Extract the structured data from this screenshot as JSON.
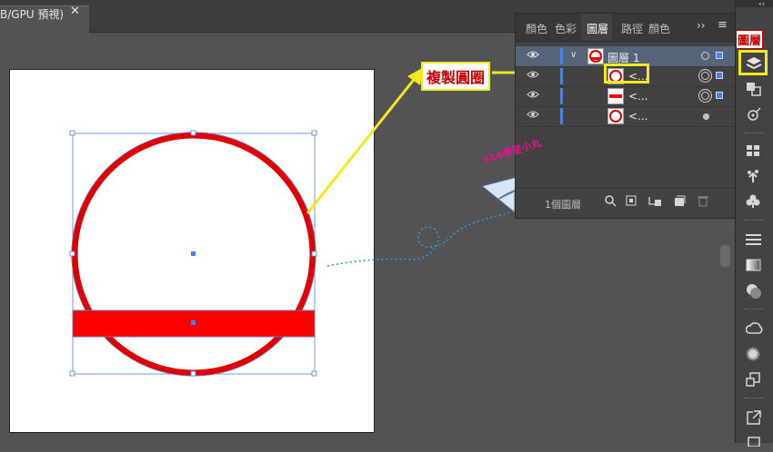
{
  "document_tab": {
    "title": "B/GPU 預視)",
    "close_label": "✕"
  },
  "panel": {
    "tabs": [
      "顏色",
      "色彩",
      "圖層",
      "路徑",
      "顏色"
    ],
    "more_label": "››",
    "menu_label": "≡",
    "layers": [
      {
        "name": "圖層 1",
        "selected": true
      },
      {
        "name": "<..."
      },
      {
        "name": "<..."
      },
      {
        "name": "<..."
      }
    ],
    "footer_count": "1個圖層"
  },
  "annotations": {
    "copy_circle": "複製圓圈",
    "layers_label": "圖層",
    "watermark": "314學堂小丸"
  },
  "dock": {
    "collapse_label": "‹‹",
    "icons": [
      "layers-icon",
      "artboards-icon",
      "asset-export-icon",
      "swatches-icon",
      "symbols-icon",
      "club-icon",
      "stroke-icon",
      "gradient-icon",
      "transparency-icon",
      "libraries-icon",
      "appearance-icon",
      "transform-icon",
      "export-icon"
    ]
  },
  "colors": {
    "shape_red": "#ff0000",
    "stroke_red": "#e00000",
    "selection_blue": "#4f82e0",
    "highlight_yellow": "#f2ea1e"
  }
}
